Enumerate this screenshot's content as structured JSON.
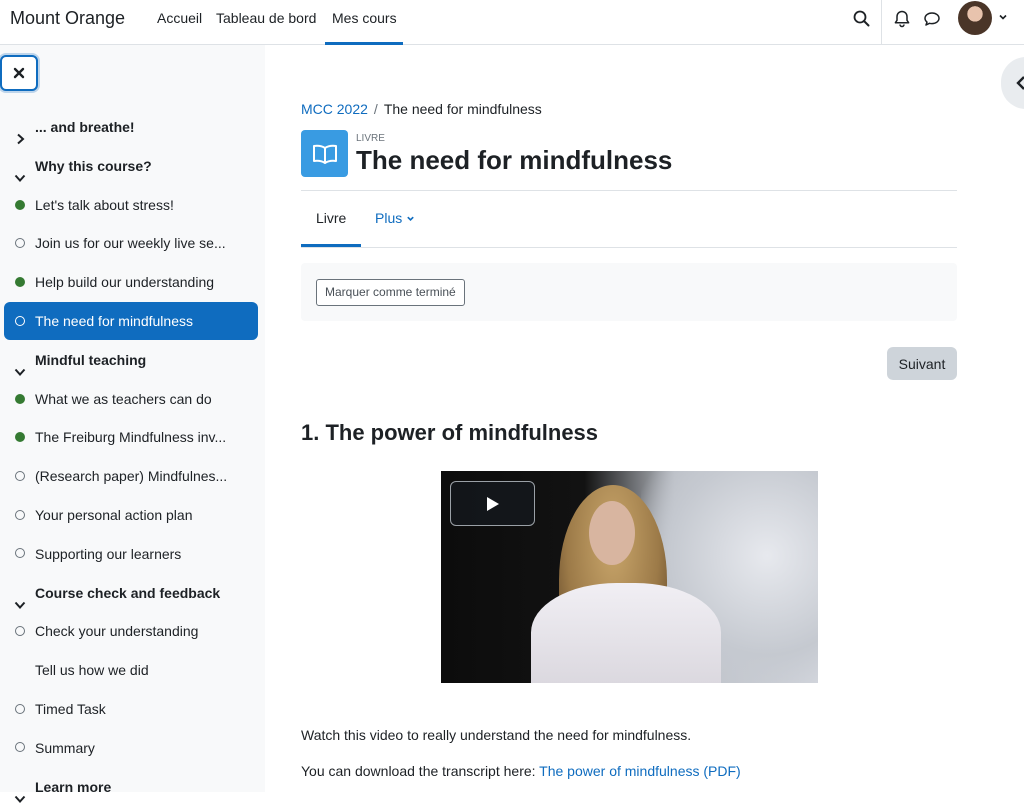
{
  "navbar": {
    "brand": "Mount Orange",
    "links": [
      {
        "label": "Accueil"
      },
      {
        "label": "Tableau de bord"
      },
      {
        "label": "Mes cours"
      }
    ],
    "active_link": "Mes cours"
  },
  "sidebar": {
    "items": [
      {
        "label": "... and breathe!",
        "type": "section",
        "state": "collapsed"
      },
      {
        "label": "Why this course?",
        "type": "section",
        "state": "expanded"
      },
      {
        "label": "Let's talk about stress!",
        "type": "activity",
        "status": "done"
      },
      {
        "label": "Join us for our weekly live se...",
        "type": "activity",
        "status": "todo"
      },
      {
        "label": "Help build our understanding",
        "type": "activity",
        "status": "done"
      },
      {
        "label": "The need for mindfulness",
        "type": "activity",
        "status": "todo",
        "active": true
      },
      {
        "label": "Mindful teaching",
        "type": "section",
        "state": "expanded"
      },
      {
        "label": "What we as teachers can do",
        "type": "activity",
        "status": "done"
      },
      {
        "label": "The Freiburg Mindfulness inv...",
        "type": "activity",
        "status": "done"
      },
      {
        "label": "(Research paper) Mindfulnes...",
        "type": "activity",
        "status": "todo"
      },
      {
        "label": "Your personal action plan",
        "type": "activity",
        "status": "todo"
      },
      {
        "label": "Supporting our learners",
        "type": "activity",
        "status": "todo"
      },
      {
        "label": "Course check and feedback",
        "type": "section",
        "state": "expanded"
      },
      {
        "label": "Check your understanding",
        "type": "activity",
        "status": "todo"
      },
      {
        "label": "Tell us how we did",
        "type": "activity",
        "status": "none"
      },
      {
        "label": "Timed Task",
        "type": "activity",
        "status": "todo"
      },
      {
        "label": "Summary",
        "type": "activity",
        "status": "todo"
      },
      {
        "label": "Learn more",
        "type": "section",
        "state": "expanded"
      }
    ]
  },
  "breadcrumb": {
    "course": "MCC 2022",
    "separator": "/",
    "current": "The need for mindfulness"
  },
  "module": {
    "type_label": "LIVRE",
    "title": "The need for mindfulness"
  },
  "tabs": {
    "livre": "Livre",
    "plus": "Plus"
  },
  "completion": {
    "button_label": "Marquer comme terminé"
  },
  "navigation": {
    "next_label": "Suivant"
  },
  "content": {
    "chapter_title": "1. The power of mindfulness",
    "paragraph1": "Watch this video to really understand the need for mindfulness.",
    "paragraph2_prefix": "You can download the transcript here: ",
    "paragraph2_link": "The power of mindfulness (PDF)"
  },
  "colors": {
    "primary": "#0f6cbf",
    "done": "#357a32",
    "sidebar_bg": "#f8f9fa",
    "book_icon_bg": "#399be2"
  },
  "icons": {
    "search": "search-icon",
    "bell": "bell-icon",
    "chat": "chat-icon",
    "close": "close-icon",
    "chevron_right": "chevron-right-icon",
    "chevron_down": "chevron-down-icon",
    "book": "book-icon",
    "play": "play-icon",
    "chevron_left": "chevron-left-icon"
  }
}
